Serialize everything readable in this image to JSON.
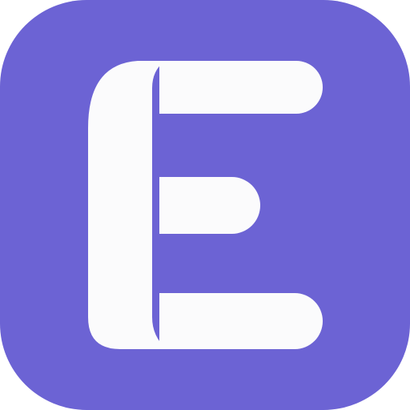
{
  "icon": {
    "name": "app-logo-e",
    "letter": "E",
    "colors": {
      "background": "#6C63D4",
      "glyph": "#FBFBFC"
    }
  }
}
